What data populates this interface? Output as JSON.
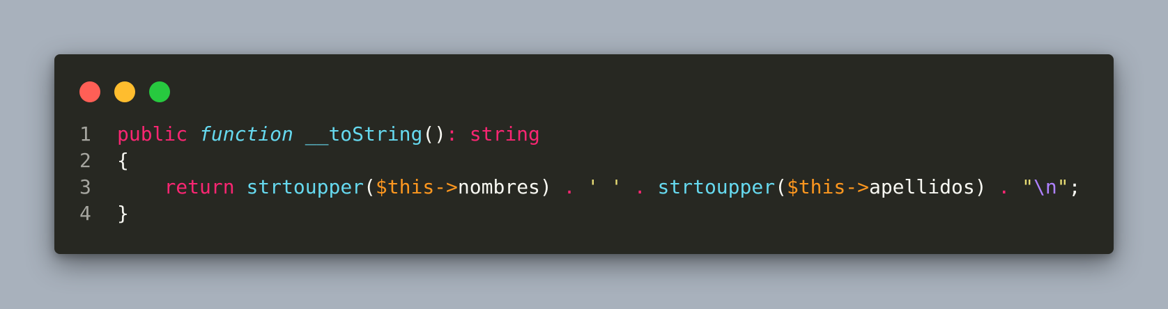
{
  "window": {
    "controls": [
      {
        "name": "close",
        "color": "#ff5f56"
      },
      {
        "name": "minimize",
        "color": "#ffbd2e"
      },
      {
        "name": "maximize",
        "color": "#27c93f"
      }
    ]
  },
  "code": {
    "language": "php",
    "lines": [
      {
        "number": "1",
        "tokens": [
          {
            "text": "public",
            "type": "kw"
          },
          {
            "text": " ",
            "type": "punc"
          },
          {
            "text": "function",
            "type": "fn-kw"
          },
          {
            "text": " ",
            "type": "punc"
          },
          {
            "text": "__toString",
            "type": "fn"
          },
          {
            "text": "()",
            "type": "punc"
          },
          {
            "text": ": string",
            "type": "kw"
          }
        ]
      },
      {
        "number": "2",
        "tokens": [
          {
            "text": "{",
            "type": "punc"
          }
        ]
      },
      {
        "number": "3",
        "tokens": [
          {
            "text": "    ",
            "type": "punc"
          },
          {
            "text": "return",
            "type": "kw"
          },
          {
            "text": " ",
            "type": "punc"
          },
          {
            "text": "strtoupper",
            "type": "fn"
          },
          {
            "text": "(",
            "type": "punc"
          },
          {
            "text": "$this->",
            "type": "var"
          },
          {
            "text": "nombres",
            "type": "punc"
          },
          {
            "text": ") ",
            "type": "punc"
          },
          {
            "text": ".",
            "type": "kw"
          },
          {
            "text": " ",
            "type": "punc"
          },
          {
            "text": "' '",
            "type": "str"
          },
          {
            "text": " ",
            "type": "punc"
          },
          {
            "text": ".",
            "type": "kw"
          },
          {
            "text": " ",
            "type": "punc"
          },
          {
            "text": "strtoupper",
            "type": "fn"
          },
          {
            "text": "(",
            "type": "punc"
          },
          {
            "text": "$this->",
            "type": "var"
          },
          {
            "text": "apellidos",
            "type": "punc"
          },
          {
            "text": ") ",
            "type": "punc"
          },
          {
            "text": ".",
            "type": "kw"
          },
          {
            "text": " ",
            "type": "punc"
          },
          {
            "text": "\"",
            "type": "str"
          },
          {
            "text": "\\n",
            "type": "esc"
          },
          {
            "text": "\"",
            "type": "str"
          },
          {
            "text": ";",
            "type": "punc"
          }
        ]
      },
      {
        "number": "4",
        "tokens": [
          {
            "text": "}",
            "type": "punc"
          }
        ]
      }
    ]
  }
}
